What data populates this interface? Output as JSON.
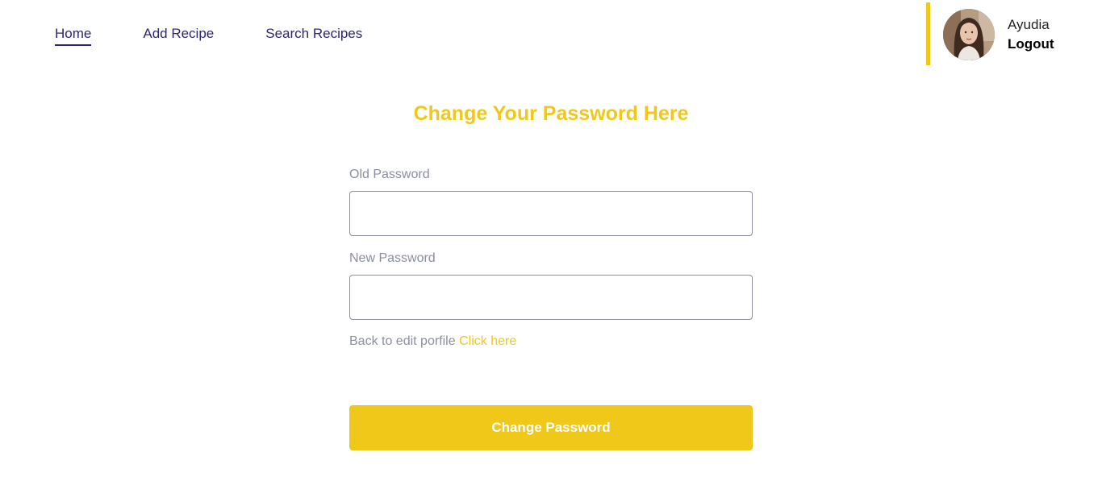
{
  "nav": {
    "links": [
      {
        "label": "Home",
        "active": true
      },
      {
        "label": "Add Recipe",
        "active": false
      },
      {
        "label": "Search Recipes",
        "active": false
      }
    ]
  },
  "user": {
    "name": "Ayudia",
    "logout_label": "Logout",
    "accent_color": "#efc81a"
  },
  "form": {
    "title": "Change Your Password Here",
    "old_password": {
      "label": "Old Password",
      "value": ""
    },
    "new_password": {
      "label": "New Password",
      "value": ""
    },
    "back_text": "Back to edit porfile",
    "back_link": "Click here",
    "submit_label": "Change Password"
  },
  "colors": {
    "accent": "#efc81a",
    "nav_text": "#2e266f",
    "label_text": "#8b8f9e"
  }
}
